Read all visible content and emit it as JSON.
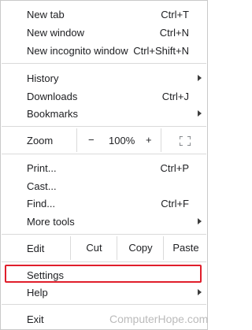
{
  "menu": {
    "new_tab": {
      "label": "New tab",
      "shortcut": "Ctrl+T"
    },
    "new_window": {
      "label": "New window",
      "shortcut": "Ctrl+N"
    },
    "new_incognito": {
      "label": "New incognito window",
      "shortcut": "Ctrl+Shift+N"
    },
    "history": {
      "label": "History"
    },
    "downloads": {
      "label": "Downloads",
      "shortcut": "Ctrl+J"
    },
    "bookmarks": {
      "label": "Bookmarks"
    },
    "zoom": {
      "label": "Zoom",
      "minus": "−",
      "value": "100%",
      "plus": "+"
    },
    "print": {
      "label": "Print...",
      "shortcut": "Ctrl+P"
    },
    "cast": {
      "label": "Cast..."
    },
    "find": {
      "label": "Find...",
      "shortcut": "Ctrl+F"
    },
    "more_tools": {
      "label": "More tools"
    },
    "edit": {
      "label": "Edit",
      "cut": "Cut",
      "copy": "Copy",
      "paste": "Paste"
    },
    "settings": {
      "label": "Settings"
    },
    "help": {
      "label": "Help"
    },
    "exit": {
      "label": "Exit"
    }
  },
  "highlight_color": "#e01e2b",
  "watermark": "ComputerHope.com"
}
